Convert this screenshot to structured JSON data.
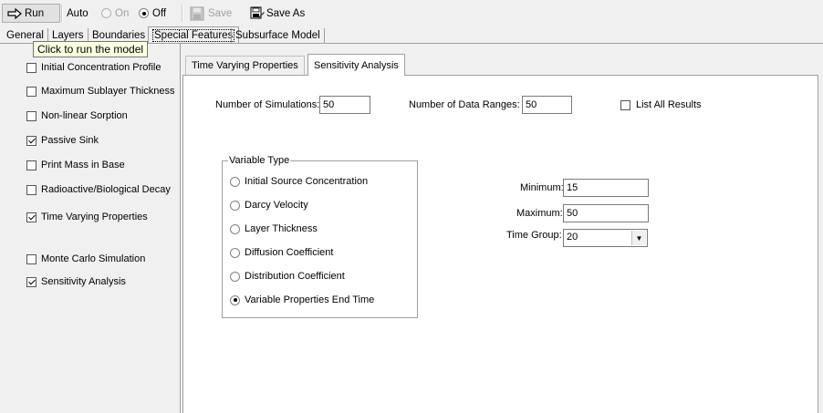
{
  "toolbar": {
    "run_label": "Run",
    "auto_label": "Auto",
    "on_label": "On",
    "off_label": "Off",
    "save_label": "Save",
    "save_as_label": "Save As",
    "auto_mode": "Off"
  },
  "tooltip": "Click to run the model",
  "main_tabs": [
    {
      "label": "General"
    },
    {
      "label": "Layers"
    },
    {
      "label": "Boundaries"
    },
    {
      "label": "Special Features",
      "active": true
    },
    {
      "label": "Subsurface Model"
    }
  ],
  "features": [
    {
      "label": "Initial Concentration Profile",
      "checked": false
    },
    {
      "label": "Maximum Sublayer Thickness",
      "checked": false
    },
    {
      "label": "Non-linear Sorption",
      "checked": false
    },
    {
      "label": "Passive Sink",
      "checked": true
    },
    {
      "label": "Print Mass in Base",
      "checked": false
    },
    {
      "label": "Radioactive/Biological Decay",
      "checked": false
    },
    {
      "label": "Time Varying Properties",
      "checked": true
    },
    {
      "label": "Monte Carlo Simulation",
      "checked": false
    },
    {
      "label": "Sensitivity Analysis",
      "checked": true
    }
  ],
  "inner_tabs": [
    {
      "label": "Time Varying Properties"
    },
    {
      "label": "Sensitivity Analysis",
      "active": true
    }
  ],
  "sensitivity": {
    "num_simulations_label": "Number of Simulations:",
    "num_simulations": "50",
    "num_data_ranges_label": "Number of Data Ranges:",
    "num_data_ranges": "50",
    "list_all_label": "List All Results",
    "list_all_checked": false,
    "variable_type_title": "Variable Type",
    "variable_types": [
      {
        "label": "Initial Source Concentration",
        "selected": false
      },
      {
        "label": "Darcy Velocity",
        "selected": false
      },
      {
        "label": "Layer Thickness",
        "selected": false
      },
      {
        "label": "Diffusion Coefficient",
        "selected": false
      },
      {
        "label": "Distribution Coefficient",
        "selected": false
      },
      {
        "label": "Variable Properties End Time",
        "selected": true
      }
    ],
    "minimum_label": "Minimum:",
    "minimum": "15",
    "maximum_label": "Maximum:",
    "maximum": "50",
    "time_group_label": "Time Group:",
    "time_group": "20"
  }
}
